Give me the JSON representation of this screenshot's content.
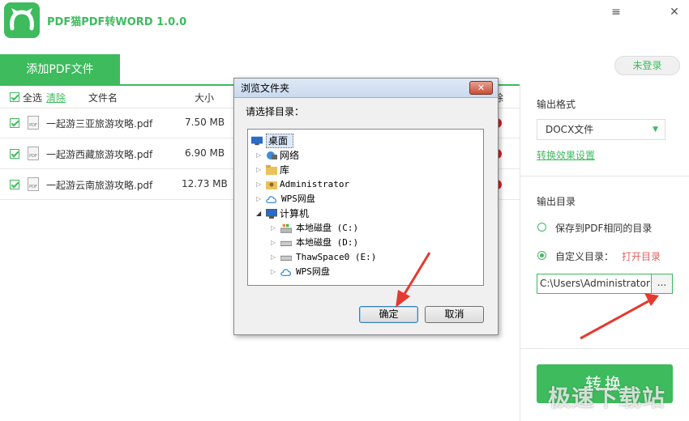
{
  "app": {
    "title": "PDF猫PDF转WORD 1.0.0",
    "brand_color": "#3dbb5d"
  },
  "window_controls": {
    "menu_icon": "≡",
    "close_icon": "✕"
  },
  "toolbar": {
    "add_pdf_label": "添加PDF文件",
    "login_label": "未登录"
  },
  "table": {
    "select_all": "全选",
    "clear": "清除",
    "col_name": "文件名",
    "col_size": "大小",
    "col_delete": "除",
    "rows": [
      {
        "name": "一起游三亚旅游攻略.pdf",
        "size": "7.50 MB",
        "icon_label": "PDF"
      },
      {
        "name": "一起游西藏旅游攻略.pdf",
        "size": "6.90 MB",
        "icon_label": "PDF"
      },
      {
        "name": "一起游云南旅游攻略.pdf",
        "size": "12.73 MB",
        "icon_label": "PDF"
      }
    ]
  },
  "right_panel": {
    "format_label": "输出格式",
    "format_value": "DOCX文件",
    "effect_settings": "转换效果设置",
    "dir_label": "输出目录",
    "option_same": "保存到PDF相同的目录",
    "option_custom": "自定义目录：",
    "open_dir": "打开目录",
    "path_value": "C:\\Users\\Administrator",
    "browse_label": "...",
    "convert_label": "转换"
  },
  "dialog": {
    "title": "浏览文件夹",
    "close_label": "✕",
    "prompt": "请选择目录：",
    "tree": {
      "desktop": "桌面",
      "network": "网络",
      "library": "库",
      "administrator": "Administrator",
      "wps_cloud": "WPS网盘",
      "computer": "计算机",
      "drive_c": "本地磁盘 (C:)",
      "drive_d": "本地磁盘 (D:)",
      "drive_e": "ThawSpace0 (E:)",
      "wps_cloud_2": "WPS网盘"
    },
    "ok_label": "确定",
    "cancel_label": "取消"
  },
  "watermark": "极速下载站"
}
